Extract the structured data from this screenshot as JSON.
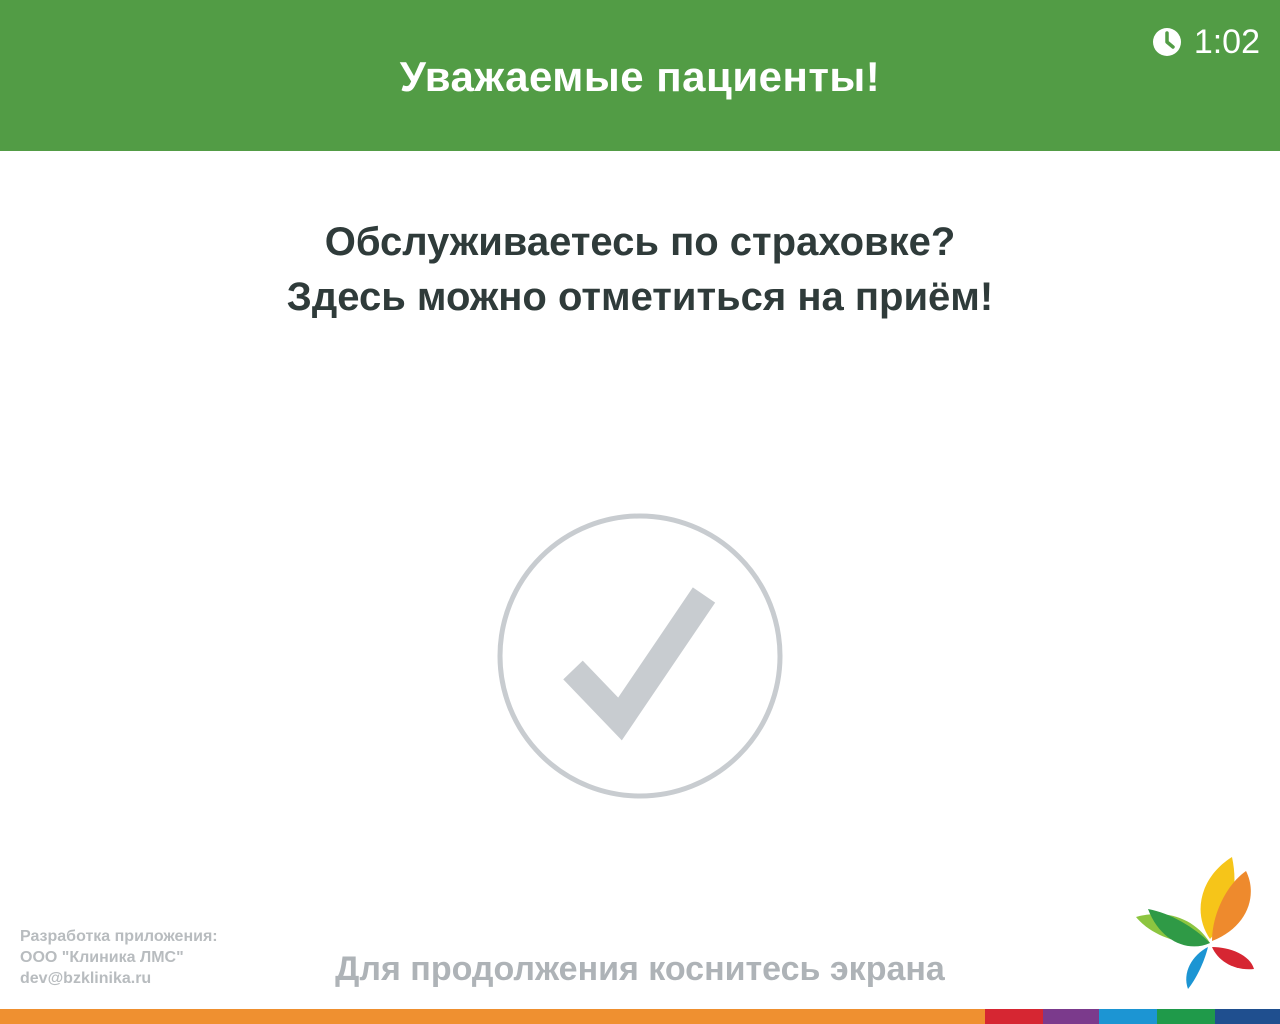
{
  "header": {
    "title": "Уважаемые пациенты!",
    "timer": {
      "icon": "clock-icon",
      "value": "1:02"
    }
  },
  "main": {
    "line1": "Обслуживаетесь по страховке?",
    "line2": "Здесь можно отметиться на приём!",
    "status_icon": "checkmark-circle-icon"
  },
  "footer": {
    "dev_label": "Разработка приложения:",
    "dev_company": "ООО \"Клиника ЛМС\"",
    "dev_email": "dev@bzklinika.ru",
    "hint": "Для продолжения коснитесь экрана",
    "logo": "clinic-butterfly-logo"
  },
  "colors": {
    "header_green": "#529c45",
    "text_dark": "#2f3b3a",
    "muted_gray": "#b8bcbf",
    "check_gray": "#c8ccd0",
    "bar": [
      "#ef9030",
      "#d62632",
      "#7b3a8c",
      "#1c95d3",
      "#1f9a4a",
      "#1f4f8f"
    ]
  }
}
